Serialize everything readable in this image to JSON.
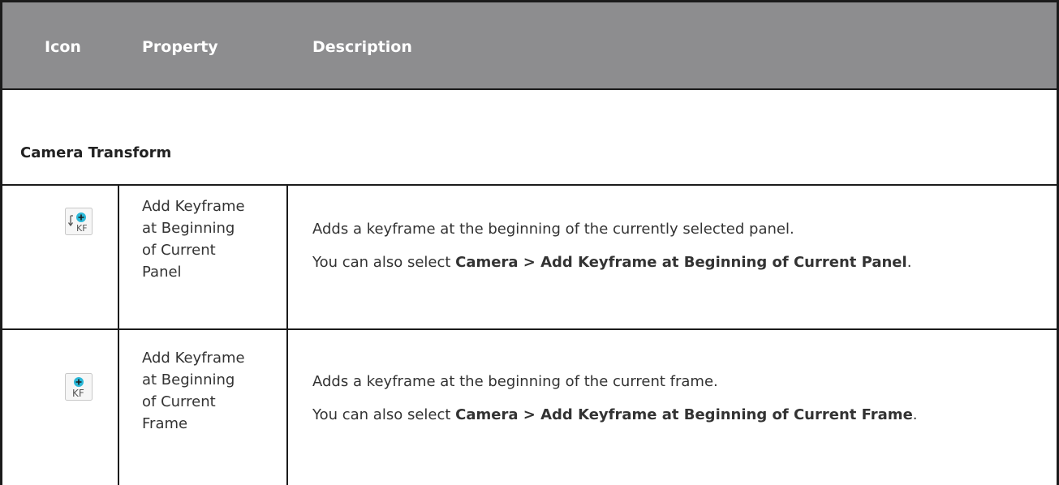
{
  "header": {
    "icon_col": "Icon",
    "property_col": "Property",
    "description_col": "Description"
  },
  "section": {
    "title": "Camera Transform"
  },
  "rows": [
    {
      "icon": "add-keyframe-beginning-panel-icon",
      "property_lines": [
        "Add Keyframe",
        "at Beginning",
        "of Current",
        "Panel"
      ],
      "description": "Adds a keyframe at the beginning of the currently selected panel.",
      "also_prefix": "You can also select ",
      "also_menu": "Camera > Add Keyframe at Beginning of Current Panel",
      "also_suffix": "."
    },
    {
      "icon": "add-keyframe-beginning-frame-icon",
      "property_lines": [
        "Add Keyframe",
        "at Beginning",
        "of Current",
        "Frame"
      ],
      "description": "Adds a keyframe at the beginning of the current frame.",
      "also_prefix": "You can also select ",
      "also_menu": "Camera > Add Keyframe at Beginning of Current Frame",
      "also_suffix": "."
    }
  ],
  "colors": {
    "header_bg": "#8d8d8f",
    "icon_accent": "#2bb8d8",
    "border": "#1b1b1b"
  }
}
